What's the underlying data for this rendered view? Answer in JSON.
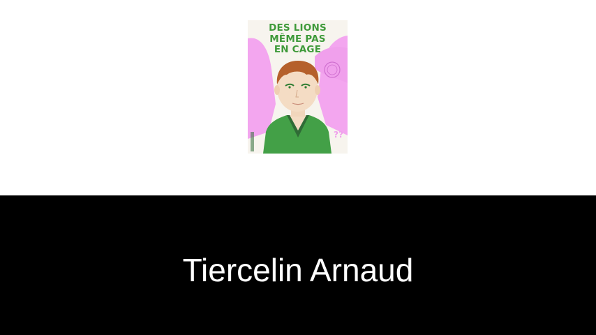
{
  "book": {
    "title_lines": [
      "DES LIONS",
      "MÊME PAS",
      "EN CAGE"
    ]
  },
  "author": {
    "name": "Tiercelin Arnaud"
  },
  "colors": {
    "banner_background": "#000000",
    "author_text": "#ffffff",
    "cover_pink": "#f3a6ef",
    "cover_green": "#3f9a3a"
  }
}
